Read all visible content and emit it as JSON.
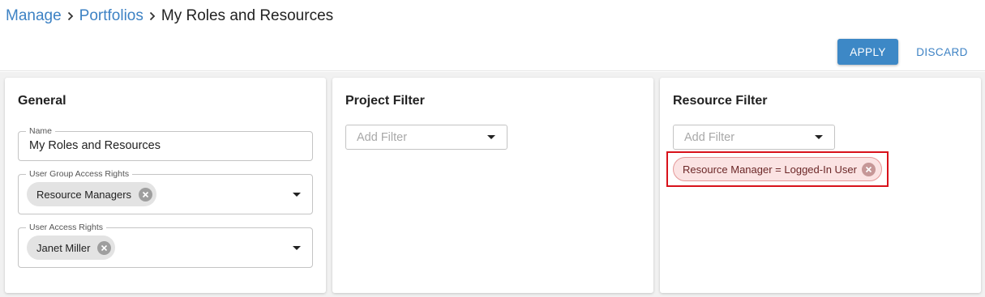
{
  "breadcrumb": {
    "items": [
      "Manage",
      "Portfolios"
    ],
    "current": "My Roles and Resources",
    "separator": "›"
  },
  "toolbar": {
    "apply_label": "APPLY",
    "discard_label": "DISCARD"
  },
  "general": {
    "title": "General",
    "name_label": "Name",
    "name_value": "My Roles and Resources",
    "user_group_label": "User Group Access Rights",
    "user_group_chips": [
      "Resource Managers"
    ],
    "user_access_label": "User Access Rights",
    "user_access_chips": [
      "Janet Miller"
    ]
  },
  "project_filter": {
    "title": "Project Filter",
    "placeholder": "Add Filter"
  },
  "resource_filter": {
    "title": "Resource Filter",
    "placeholder": "Add Filter",
    "active_filters": [
      "Resource Manager = Logged-In User"
    ]
  },
  "icons": {
    "remove": "close-circle-icon",
    "dropdown": "caret-down-icon",
    "separator": "chevron-right-icon"
  },
  "colors": {
    "accent": "#3d88c6",
    "link": "#3d82c4",
    "highlight": "#d8121b",
    "chip": "#e3e3e3",
    "filter_chip": "#fbe3e3"
  }
}
